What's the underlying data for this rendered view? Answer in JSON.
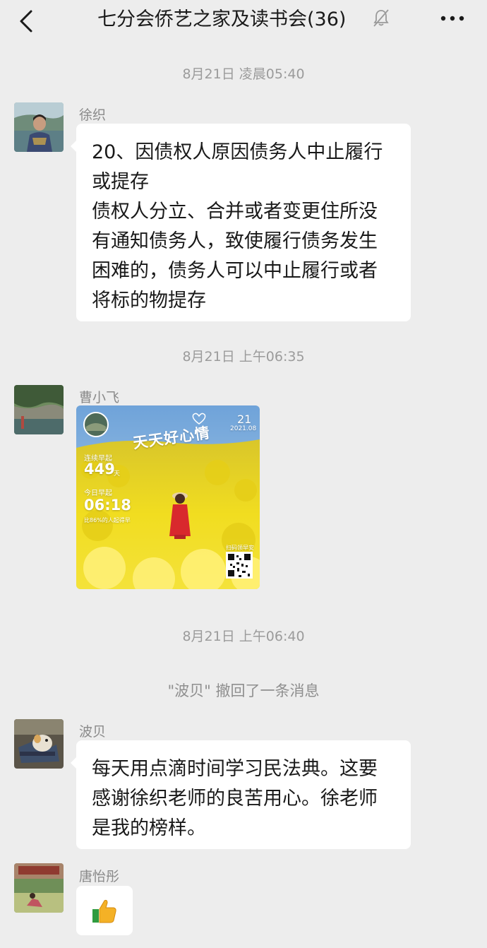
{
  "header": {
    "back_icon": "chevron-left-icon",
    "title": "七分会侨艺之家及读书会(36)",
    "mute_icon": "bell-muted-icon",
    "more_icon": "ellipsis-icon"
  },
  "messages": [
    {
      "timestamp": "8月21日 凌晨05:40",
      "sender": "徐织",
      "lines": [
        "20、因债权人原因债务人中止履行",
        "或提存",
        "债权人分立、合并或者变更住所没",
        "有通知债务人，致使履行债务发生",
        "困难的，债务人可以中止履行或者",
        "将标的物提存"
      ]
    },
    {
      "timestamp": "8月21日 上午06:35",
      "sender": "曹小飞",
      "image_card": {
        "headline": "天天好心情",
        "day": "21",
        "month": "2021.08",
        "streak_label": "连续早起",
        "streak_value": "449",
        "streak_unit": "天",
        "today_label": "今日早起",
        "today_time": "06:18",
        "rank_text": "比86%的人起得早",
        "qr_label": "扫码领早安"
      }
    },
    {
      "timestamp": "8月21日 上午06:40",
      "system": "\"波贝\" 撤回了一条消息",
      "sender": "波贝",
      "lines": [
        "每天用点滴时间学习民法典。这要",
        "感谢徐织老师的良苦用心。徐老师",
        "是我的榜样。"
      ]
    },
    {
      "sender": "唐怡彤",
      "emoji": "thumbs-up-icon"
    }
  ],
  "colors": {
    "background": "#ededed",
    "bubble": "#ffffff",
    "meta_text": "#9b9b9b"
  }
}
